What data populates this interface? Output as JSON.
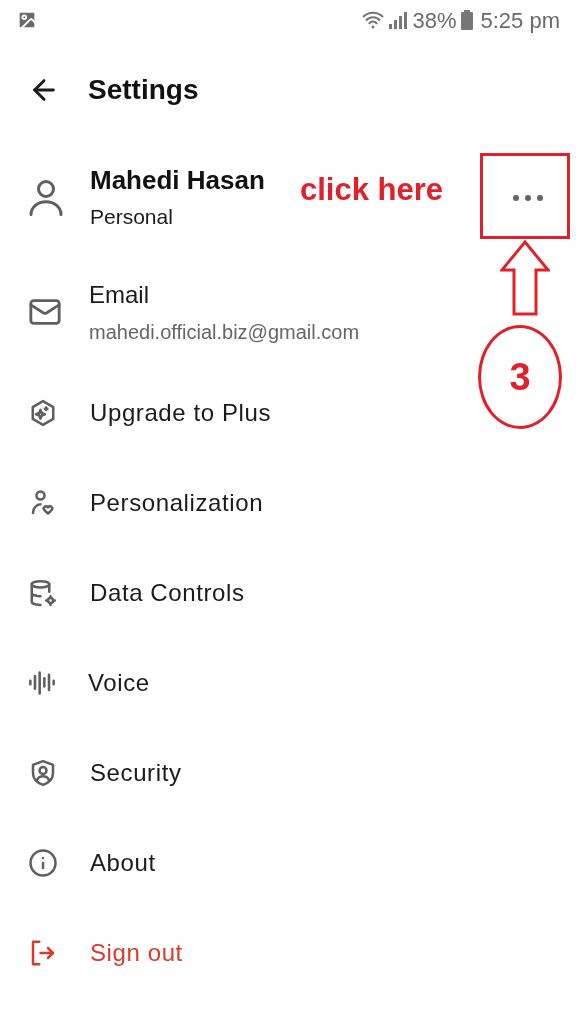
{
  "status_bar": {
    "battery": "38%",
    "time": "5:25 pm"
  },
  "header": {
    "title": "Settings"
  },
  "profile": {
    "name": "Mahedi Hasan",
    "plan": "Personal"
  },
  "email": {
    "label": "Email",
    "value": "mahedi.official.biz@gmail.com"
  },
  "menu": [
    {
      "label": "Upgrade to Plus",
      "kind": "normal"
    },
    {
      "label": "Personalization",
      "kind": "normal"
    },
    {
      "label": "Data Controls",
      "kind": "normal"
    },
    {
      "label": "Voice",
      "kind": "normal"
    },
    {
      "label": "Security",
      "kind": "normal"
    },
    {
      "label": "About",
      "kind": "normal"
    },
    {
      "label": "Sign out",
      "kind": "danger"
    }
  ],
  "annotation": {
    "callout": "click here",
    "step": "3"
  }
}
